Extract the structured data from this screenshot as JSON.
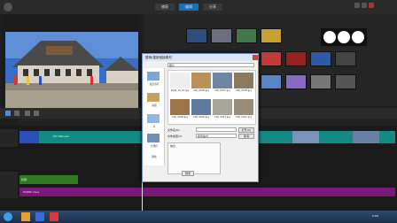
{
  "app": {
    "tabs": [
      "捕获",
      "编辑",
      "分享"
    ],
    "active_tab": 1,
    "logo": "Corel"
  },
  "timeline": {
    "clip_video_label": "DV DBa.aas",
    "clip_title_label": "标题",
    "clip_audio_label": "DVRBC.mpa",
    "time_display": "00:00:00:00"
  },
  "dialog": {
    "title": "替换/重新链接素材",
    "path": "照片",
    "files": [
      {
        "name": "2020_10_22.jpg",
        "color": "#eeeeee"
      },
      {
        "name": "100_0006.jpg",
        "color": "#b8925a"
      },
      {
        "name": "100_0007.jpg",
        "color": "#6d86a5"
      },
      {
        "name": "100_0008.jpg",
        "color": "#8a7a5e"
      },
      {
        "name": "100_0009.jpg",
        "color": "#a0744a"
      },
      {
        "name": "100_0010.jpg",
        "color": "#5f7aa0"
      },
      {
        "name": "100_0011.jpg",
        "color": "#aaa39a"
      },
      {
        "name": "100_0012.jpg",
        "color": "#9b8c7a"
      }
    ],
    "sidebar": [
      "最近访问",
      "桌面",
      "库",
      "计算机",
      "网络"
    ],
    "filename_label": "文件名(N):",
    "filetype_label": "文件类型(T):",
    "filetype_value": "所有格式",
    "open_button": "打开(O)",
    "cancel_button": "取消",
    "info_label": "信息",
    "preview_button": "预览"
  },
  "taskbar": {
    "clock": "0:00"
  }
}
